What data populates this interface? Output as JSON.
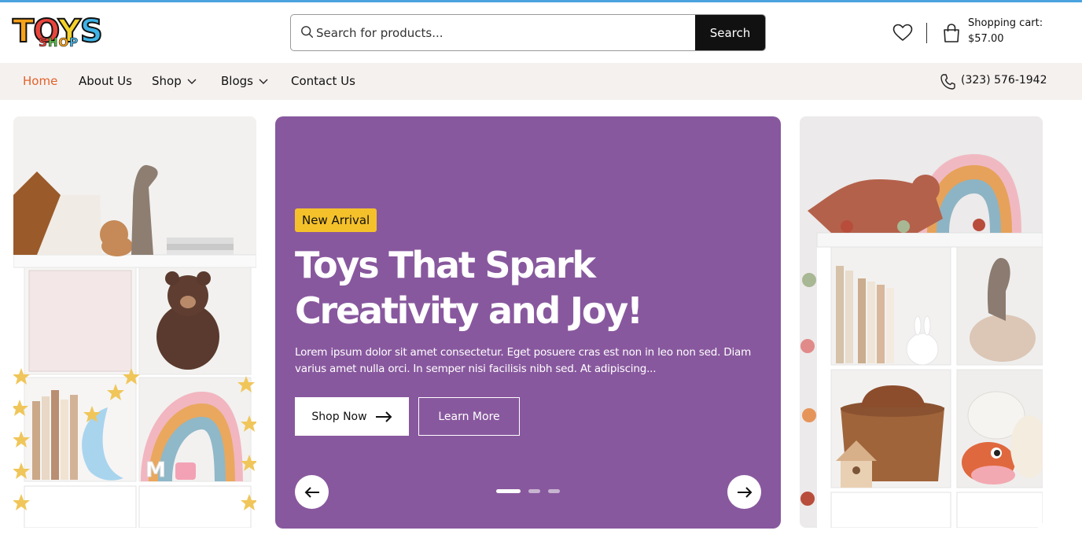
{
  "brand": {
    "logo_top": "TOYS",
    "logo_bottom": "SHOP"
  },
  "search": {
    "placeholder": "Search for products...",
    "button_label": "Search"
  },
  "cart": {
    "label": "Shopping cart:",
    "total": "$57.00"
  },
  "nav": {
    "items": [
      {
        "label": "Home",
        "active": true
      },
      {
        "label": "About Us"
      },
      {
        "label": "Shop",
        "dropdown": true
      },
      {
        "label": "Blogs",
        "dropdown": true
      },
      {
        "label": "Contact Us"
      }
    ],
    "phone": "(323) 576-1942"
  },
  "hero": {
    "badge": "New Arrival",
    "title": "Toys That Spark Creativity and Joy!",
    "description": "Lorem ipsum dolor sit amet consectetur. Eget posuere cras est non in leo non sed. Diam varius amet nulla orci. In semper nisi facilisis nibh sed. At adipiscing...",
    "primary_button": "Shop Now",
    "secondary_button": "Learn More",
    "slides_total": 3,
    "active_slide": 1
  },
  "colors": {
    "accent_orange": "#e2622a",
    "hero_purple": "#88589e",
    "badge_yellow": "#f5c12a",
    "nav_bg": "#f5f1ef"
  }
}
